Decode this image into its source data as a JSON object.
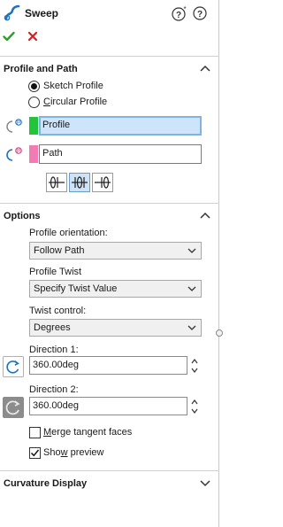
{
  "header": {
    "title": "Sweep"
  },
  "profile_and_path": {
    "title": "Profile and Path",
    "sketch_profile": "Sketch Profile",
    "sketch_profile_checked": true,
    "circular_profile": "Circular Profile",
    "circular_profile_checked": false,
    "profile_field": "Profile",
    "path_field": "Path",
    "profile_color": "#22c43a",
    "path_color": "#f37ab5",
    "twist_buttons": [
      {
        "icon": "twist-direction-1-icon",
        "selected": false
      },
      {
        "icon": "twist-bidirectional-icon",
        "selected": true
      },
      {
        "icon": "twist-direction-2-icon",
        "selected": false
      }
    ]
  },
  "options": {
    "title": "Options",
    "orientation_label": "Profile orientation:",
    "orientation_value": "Follow Path",
    "twist_label": "Profile Twist",
    "twist_value": "Specify Twist Value",
    "control_label": "Twist control:",
    "control_value": "Degrees",
    "direction1_label": "Direction 1:",
    "direction1_value": "360.00deg",
    "direction2_label": "Direction 2:",
    "direction2_value": "360.00deg",
    "merge_prefix": "",
    "merge_mnemonic": "M",
    "merge_suffix": "erge tangent faces",
    "merge_checked": false,
    "preview_prefix": "Sho",
    "preview_mnemonic": "w",
    "preview_suffix": " preview",
    "preview_checked": true
  },
  "curvature": {
    "title": "Curvature Display"
  },
  "colors": {
    "accent": "#1f73c4",
    "ok": "#2e9e2e",
    "cancel": "#d42020"
  }
}
